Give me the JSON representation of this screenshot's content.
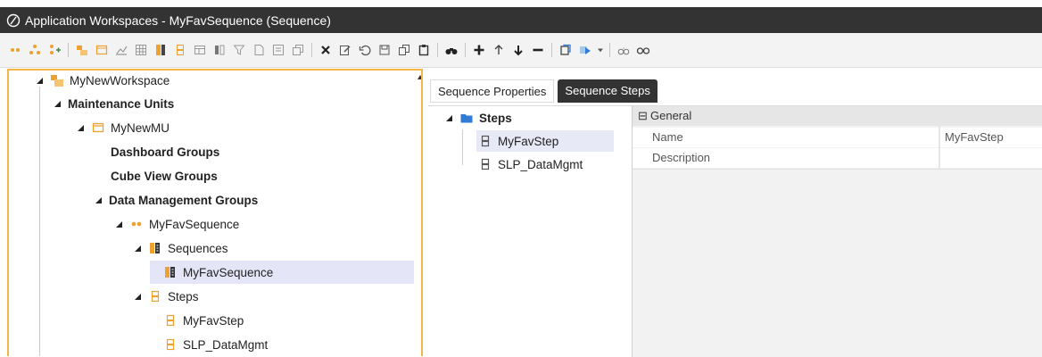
{
  "window": {
    "title": "Application Workspaces - MyFavSequence (Sequence)"
  },
  "toolbar": {
    "icons": [
      "dots-icon",
      "tree-icon",
      "tree-add-icon",
      "workspace-icon",
      "mu-icon",
      "chart-icon",
      "grid-icon",
      "sequence-icon",
      "step-icon",
      "table-icon",
      "columns-icon",
      "filter-icon",
      "doc-icon",
      "form-icon",
      "window-icon",
      "delete-icon",
      "edit-icon",
      "undo-icon",
      "save-icon",
      "copy-icon",
      "paste-icon",
      "binoculars-icon",
      "add-icon",
      "up-icon",
      "down-icon",
      "remove-icon",
      "open-icon",
      "run-icon",
      "dropdown-icon",
      "search-icon",
      "glasses-icon"
    ]
  },
  "tree": {
    "workspace": "MyNewWorkspace",
    "maintenance_units": "Maintenance Units",
    "mu": "MyNewMU",
    "dashboard_groups": "Dashboard Groups",
    "cube_view_groups": "Cube View Groups",
    "dm_groups": "Data Management Groups",
    "dm_group": "MyFavSequence",
    "sequences": "Sequences",
    "sequence": "MyFavSequence",
    "steps": "Steps",
    "step1": "MyFavStep",
    "step2": "SLP_DataMgmt"
  },
  "tabs": {
    "properties": "Sequence Properties",
    "steps": "Sequence Steps"
  },
  "steps_tree": {
    "root": "Steps",
    "items": [
      "MyFavStep",
      "SLP_DataMgmt"
    ]
  },
  "property_grid": {
    "category": "General",
    "rows": [
      {
        "name": "Name",
        "value": "MyFavStep"
      },
      {
        "name": "Description",
        "value": ""
      }
    ]
  },
  "colors": {
    "accent_orange": "#f3b54a",
    "selection": "#e4e6f7",
    "titlebar": "#333333"
  }
}
